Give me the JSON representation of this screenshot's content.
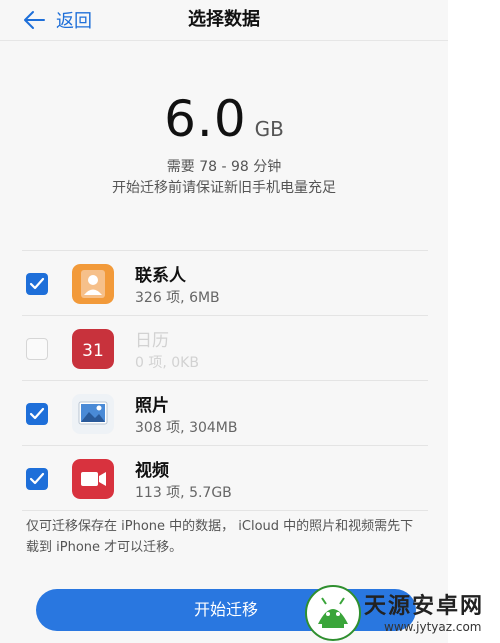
{
  "header": {
    "back_label": "返回",
    "title": "选择数据"
  },
  "summary": {
    "size_value": "6.0",
    "size_unit": "GB",
    "time_estimate": "需要 78 - 98 分钟",
    "battery_note": "开始迁移前请保证新旧手机电量充足"
  },
  "items": [
    {
      "name": "联系人",
      "detail": "326 项, 6MB",
      "checked": true,
      "icon": "contacts-icon",
      "color": "#f29a3a"
    },
    {
      "name": "日历",
      "detail": "0 项, 0KB",
      "checked": false,
      "icon": "calendar-icon",
      "icon_text": "31",
      "color": "#c8323c"
    },
    {
      "name": "照片",
      "detail": "308 项, 304MB",
      "checked": true,
      "icon": "photos-icon",
      "color": "#3a7fd0"
    },
    {
      "name": "视频",
      "detail": "113 项, 5.7GB",
      "checked": true,
      "icon": "video-icon",
      "color": "#d8323e"
    }
  ],
  "footer": {
    "note": "仅可迁移保存在 iPhone 中的数据， iCloud 中的照片和视频需先下载到 iPhone 才可以迁移。",
    "start_button": "开始迁移"
  },
  "watermark": {
    "title": "天源安卓网",
    "url": "www.jytyaz.com"
  },
  "colors": {
    "accent": "#1e6fd9",
    "button": "#2977e0"
  }
}
